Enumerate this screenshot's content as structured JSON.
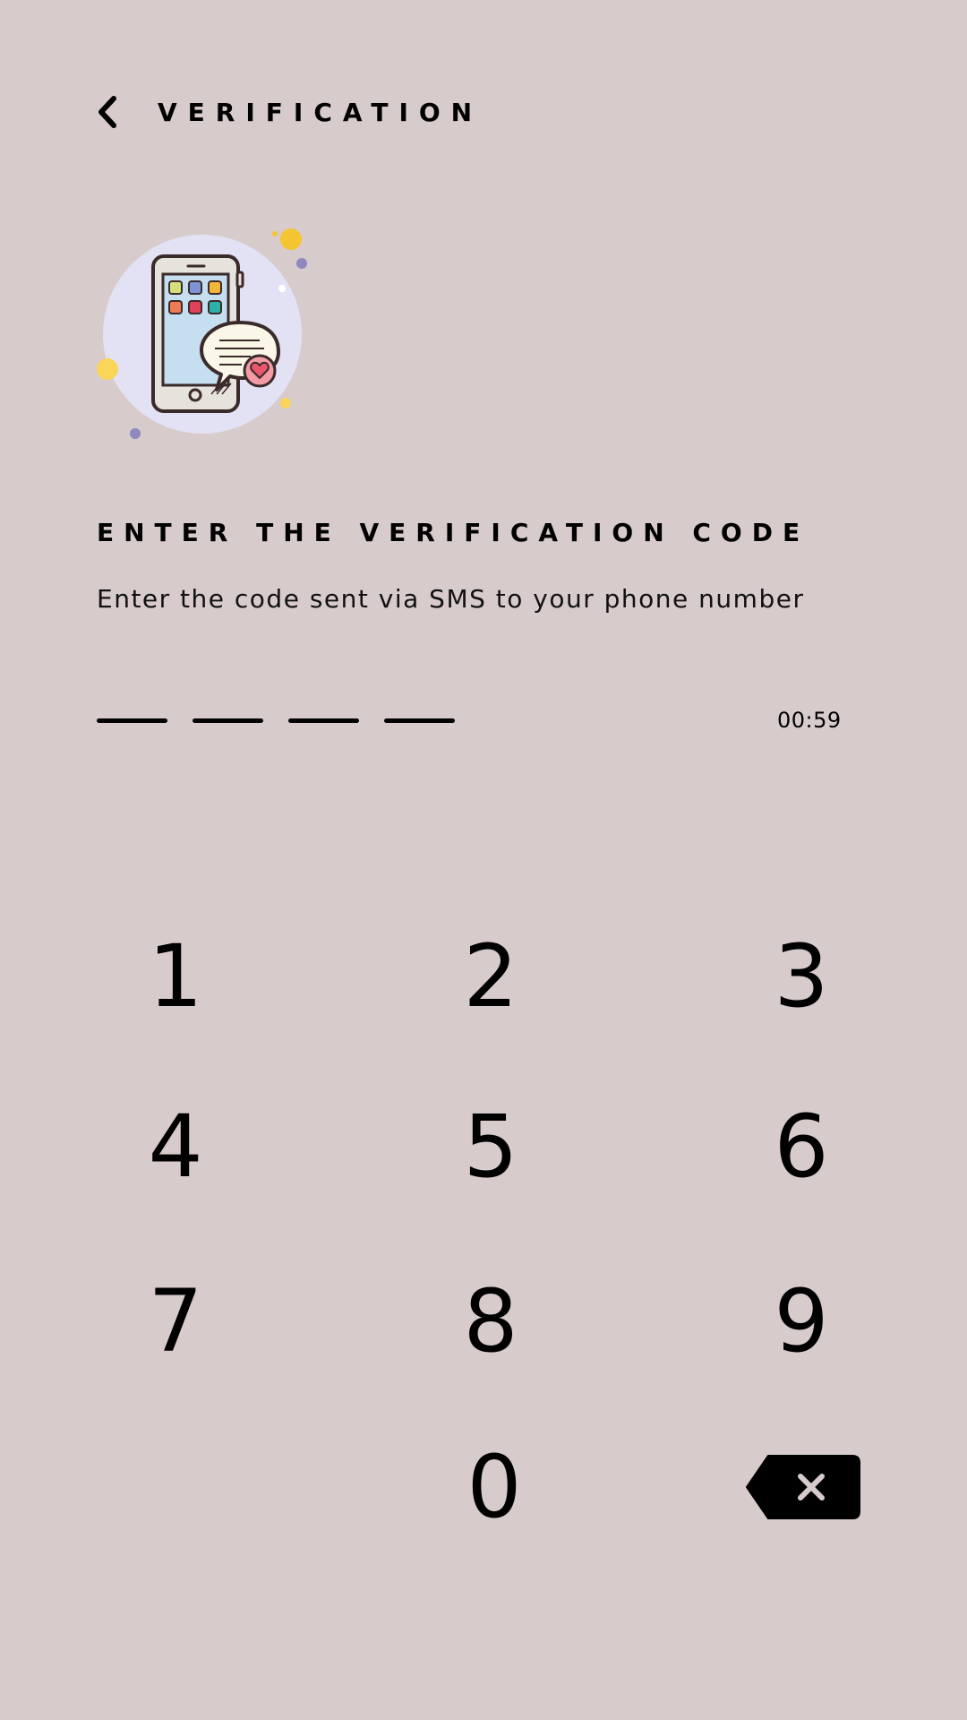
{
  "header": {
    "back_icon": "chevron-left-icon",
    "title": "VERIFICATION"
  },
  "illustration": {
    "icon": "phone-sms-message-heart-illustration",
    "colors": {
      "circle": "#e3e2f5",
      "phone_outline": "#3b2a2a",
      "screen": "#c5dff0",
      "bubble": "#faf6e8",
      "heart": "#e8576b",
      "dot_yellow": "#f5c431",
      "dot_purple": "#8e8ac0"
    }
  },
  "content": {
    "heading": "ENTER THE VERIFICATION CODE",
    "subtext": "Enter the code sent via SMS to your phone number"
  },
  "code_input": {
    "slot_count": 4,
    "timer": "00:59"
  },
  "keypad": {
    "keys": [
      "1",
      "2",
      "3",
      "4",
      "5",
      "6",
      "7",
      "8",
      "9",
      "0"
    ],
    "backspace_icon": "backspace-icon"
  },
  "colors": {
    "background": "#d8cbcc",
    "text": "#000000"
  }
}
